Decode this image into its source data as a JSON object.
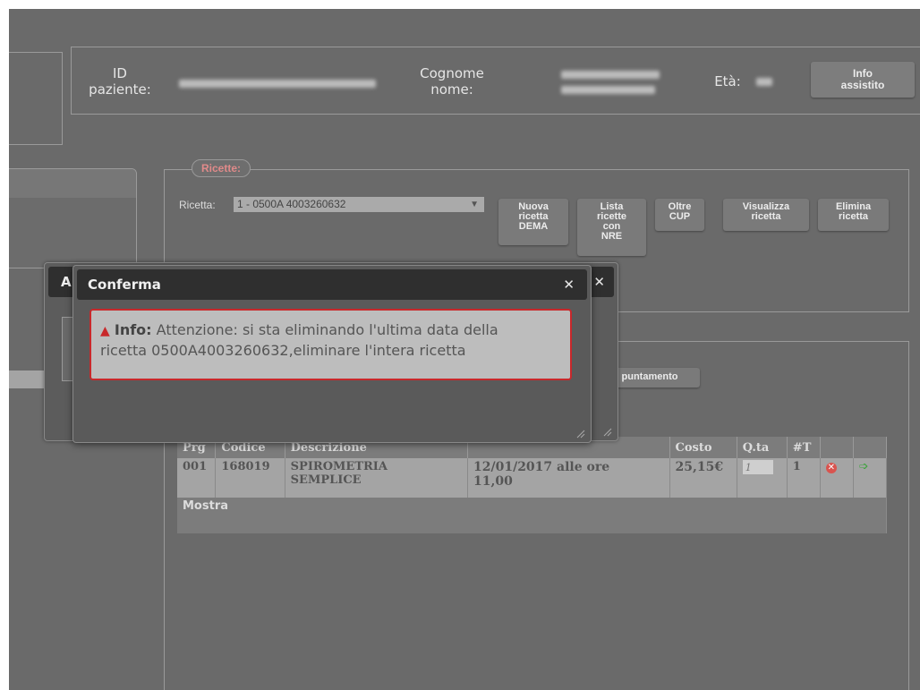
{
  "header": {
    "id_label_1": "ID",
    "id_label_2": "paziente:",
    "name_label_1": "Cognome",
    "name_label_2": "nome:",
    "age_label": "Età:",
    "info_button_1": "Info",
    "info_button_2": "assistito"
  },
  "ricette": {
    "legend": "Ricette:",
    "select_label": "Ricetta:",
    "select_value": "1 - 0500A 4003260632",
    "buttons": {
      "nuova": [
        "Nuova",
        "ricetta",
        "DEMA"
      ],
      "lista": [
        "Lista",
        "ricette",
        "con",
        "NRE"
      ],
      "oltre": [
        "Oltre",
        "CUP"
      ],
      "visualizza": [
        "Visualizza",
        "ricetta"
      ],
      "elimina": [
        "Elimina",
        "ricetta"
      ]
    }
  },
  "appuntamento_button": "puntamento",
  "table": {
    "headers": [
      "Prg",
      "Codice",
      "Descrizione",
      "",
      "Costo",
      "Q.ta",
      "#T",
      "",
      ""
    ],
    "row": {
      "prg": "001",
      "codice": "168019",
      "descrizione_1": "SPIROMETRIA",
      "descrizione_2": "SEMPLICE",
      "data_1": "12/01/2017 alle ore",
      "data_2": "11,00",
      "costo": "25,15€",
      "qta_placeholder": "1",
      "t": "1"
    },
    "footer": "Mostra"
  },
  "back_dialog": {
    "title_initial": "A"
  },
  "dialog": {
    "title": "Conferma",
    "info_label": "Info:",
    "message_line1": "Attenzione: si sta eliminando l'ultima data della",
    "message_line2": "ricetta 0500A4003260632,eliminare l'intera ricetta"
  },
  "colors": {
    "background": "#6a6a6a",
    "alert_border": "#c8282b",
    "legend_text": "#e08a8a"
  }
}
